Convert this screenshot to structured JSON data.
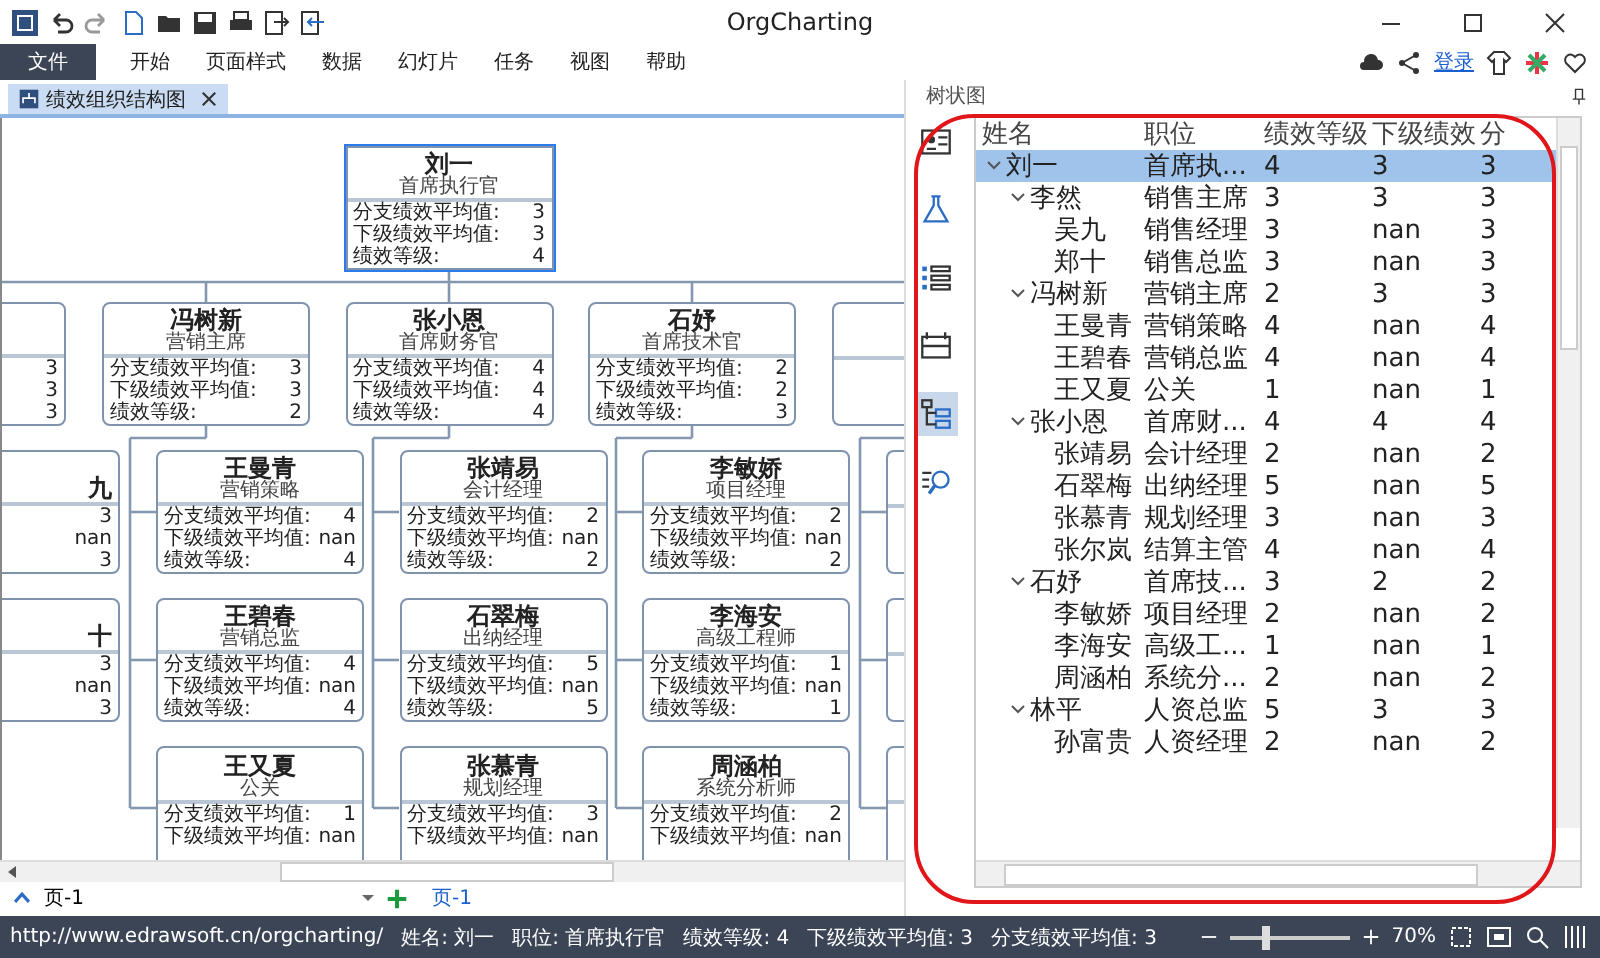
{
  "window": {
    "title": "OrgCharting"
  },
  "menu": [
    {
      "label": "文件",
      "selected": true
    },
    {
      "label": "开始",
      "selected": false
    },
    {
      "label": "页面样式",
      "selected": false
    },
    {
      "label": "数据",
      "selected": false
    },
    {
      "label": "幻灯片",
      "selected": false
    },
    {
      "label": "任务",
      "selected": false
    },
    {
      "label": "视图",
      "selected": false
    },
    {
      "label": "帮助",
      "selected": false
    }
  ],
  "login": "登录",
  "doc_tab": {
    "label": "绩效组织结构图"
  },
  "chart": {
    "root": {
      "kind": "full",
      "name": "刘一",
      "title": "首席执行官",
      "rows": [
        {
          "label": "分支绩效平均值:",
          "value": "3"
        },
        {
          "label": "下级绩效平均值:",
          "value": "3"
        },
        {
          "label": "绩效等级:",
          "value": "4"
        }
      ]
    },
    "columns": [
      {
        "head": {
          "kind": "cut_left",
          "rows": [
            {
              "value": "3"
            },
            {
              "value": "3"
            },
            {
              "value": "3"
            }
          ]
        },
        "children": [
          {
            "kind": "cut_left",
            "name": "九",
            "rows": [
              {
                "value": "3"
              },
              {
                "value": "nan"
              },
              {
                "value": "3"
              }
            ]
          },
          {
            "kind": "cut_left",
            "name": "十",
            "rows": [
              {
                "value": "3"
              },
              {
                "value": "nan"
              },
              {
                "value": "3"
              }
            ]
          }
        ]
      },
      {
        "head": {
          "kind": "full",
          "name": "冯树新",
          "title": "营销主席",
          "rows": [
            {
              "label": "分支绩效平均值:",
              "value": "3"
            },
            {
              "label": "下级绩效平均值:",
              "value": "3"
            },
            {
              "label": "绩效等级:",
              "value": "2"
            }
          ]
        },
        "children": [
          {
            "kind": "full",
            "name": "王曼青",
            "title": "营销策略",
            "rows": [
              {
                "label": "分支绩效平均值:",
                "value": "4"
              },
              {
                "label": "下级绩效平均值:",
                "value": "nan"
              },
              {
                "label": "绩效等级:",
                "value": "4"
              }
            ]
          },
          {
            "kind": "full",
            "name": "王碧春",
            "title": "营销总监",
            "rows": [
              {
                "label": "分支绩效平均值:",
                "value": "4"
              },
              {
                "label": "下级绩效平均值:",
                "value": "nan"
              },
              {
                "label": "绩效等级:",
                "value": "4"
              }
            ]
          },
          {
            "kind": "full",
            "name": "王又夏",
            "title": "公关",
            "rows": [
              {
                "label": "分支绩效平均值:",
                "value": "1"
              },
              {
                "label": "下级绩效平均值:",
                "value": "nan"
              }
            ]
          }
        ]
      },
      {
        "head": {
          "kind": "full",
          "name": "张小恩",
          "title": "首席财务官",
          "rows": [
            {
              "label": "分支绩效平均值:",
              "value": "4"
            },
            {
              "label": "下级绩效平均值:",
              "value": "4"
            },
            {
              "label": "绩效等级:",
              "value": "4"
            }
          ]
        },
        "children": [
          {
            "kind": "full",
            "name": "张靖易",
            "title": "会计经理",
            "rows": [
              {
                "label": "分支绩效平均值:",
                "value": "2"
              },
              {
                "label": "下级绩效平均值:",
                "value": "nan"
              },
              {
                "label": "绩效等级:",
                "value": "2"
              }
            ]
          },
          {
            "kind": "full",
            "name": "石翠梅",
            "title": "出纳经理",
            "rows": [
              {
                "label": "分支绩效平均值:",
                "value": "5"
              },
              {
                "label": "下级绩效平均值:",
                "value": "nan"
              },
              {
                "label": "绩效等级:",
                "value": "5"
              }
            ]
          },
          {
            "kind": "full",
            "name": "张慕青",
            "title": "规划经理",
            "rows": [
              {
                "label": "分支绩效平均值:",
                "value": "3"
              },
              {
                "label": "下级绩效平均值:",
                "value": "nan"
              }
            ]
          }
        ]
      },
      {
        "head": {
          "kind": "full",
          "name": "石妤",
          "title": "首席技术官",
          "rows": [
            {
              "label": "分支绩效平均值:",
              "value": "2"
            },
            {
              "label": "下级绩效平均值:",
              "value": "2"
            },
            {
              "label": "绩效等级:",
              "value": "3"
            }
          ]
        },
        "children": [
          {
            "kind": "full",
            "name": "李敏娇",
            "title": "项目经理",
            "rows": [
              {
                "label": "分支绩效平均值:",
                "value": "2"
              },
              {
                "label": "下级绩效平均值:",
                "value": "nan"
              },
              {
                "label": "绩效等级:",
                "value": "2"
              }
            ]
          },
          {
            "kind": "full",
            "name": "李海安",
            "title": "高级工程师",
            "rows": [
              {
                "label": "分支绩效平均值:",
                "value": "1"
              },
              {
                "label": "下级绩效平均值:",
                "value": "nan"
              },
              {
                "label": "绩效等级:",
                "value": "1"
              }
            ]
          },
          {
            "kind": "full",
            "name": "周涵柏",
            "title": "系统分析师",
            "rows": [
              {
                "label": "分支绩效平均值:",
                "value": "2"
              },
              {
                "label": "下级绩效平均值:",
                "value": "nan"
              }
            ]
          }
        ]
      },
      {
        "head": {
          "kind": "cut_right"
        },
        "children": [
          {
            "kind": "cut_right"
          },
          {
            "kind": "cut_right"
          },
          {
            "kind": "cut_right"
          }
        ]
      }
    ]
  },
  "page_bar": {
    "dropdown": "页-1",
    "tabs": [
      {
        "label": "页-1",
        "selected": true
      }
    ]
  },
  "tree_panel": {
    "title": "树状图",
    "side_icons": [
      {
        "kind": "card",
        "selected": false
      },
      {
        "kind": "flask",
        "selected": false
      },
      {
        "kind": "list",
        "selected": false
      },
      {
        "kind": "board",
        "selected": false
      },
      {
        "kind": "tree",
        "selected": true
      },
      {
        "kind": "search",
        "selected": false
      }
    ],
    "columns": [
      "姓名",
      "职位",
      "绩效等级",
      "下级绩效",
      "分"
    ],
    "rows": [
      {
        "cells": [
          "刘一",
          "首席执...",
          "4",
          "3",
          "3"
        ],
        "expanded": true,
        "selected": true,
        "children": [
          {
            "cells": [
              "李然",
              "销售主席",
              "3",
              "3",
              "3"
            ],
            "expanded": true,
            "selected": false,
            "children": [
              {
                "cells": [
                  "吴九",
                  "销售经理",
                  "3",
                  "nan",
                  "3"
                ],
                "selected": false
              },
              {
                "cells": [
                  "郑十",
                  "销售总监",
                  "3",
                  "nan",
                  "3"
                ],
                "selected": false
              }
            ]
          },
          {
            "cells": [
              "冯树新",
              "营销主席",
              "2",
              "3",
              "3"
            ],
            "expanded": true,
            "selected": false,
            "children": [
              {
                "cells": [
                  "王曼青",
                  "营销策略",
                  "4",
                  "nan",
                  "4"
                ],
                "selected": false
              },
              {
                "cells": [
                  "王碧春",
                  "营销总监",
                  "4",
                  "nan",
                  "4"
                ],
                "selected": false
              },
              {
                "cells": [
                  "王又夏",
                  "公关",
                  "1",
                  "nan",
                  "1"
                ],
                "selected": false
              }
            ]
          },
          {
            "cells": [
              "张小恩",
              "首席财...",
              "4",
              "4",
              "4"
            ],
            "expanded": true,
            "selected": false,
            "children": [
              {
                "cells": [
                  "张靖易",
                  "会计经理",
                  "2",
                  "nan",
                  "2"
                ],
                "selected": false
              },
              {
                "cells": [
                  "石翠梅",
                  "出纳经理",
                  "5",
                  "nan",
                  "5"
                ],
                "selected": false
              },
              {
                "cells": [
                  "张慕青",
                  "规划经理",
                  "3",
                  "nan",
                  "3"
                ],
                "selected": false
              },
              {
                "cells": [
                  "张尔岚",
                  "结算主管",
                  "4",
                  "nan",
                  "4"
                ],
                "selected": false
              }
            ]
          },
          {
            "cells": [
              "石妤",
              "首席技...",
              "3",
              "2",
              "2"
            ],
            "expanded": true,
            "selected": false,
            "children": [
              {
                "cells": [
                  "李敏娇",
                  "项目经理",
                  "2",
                  "nan",
                  "2"
                ],
                "selected": false
              },
              {
                "cells": [
                  "李海安",
                  "高级工...",
                  "1",
                  "nan",
                  "1"
                ],
                "selected": false
              },
              {
                "cells": [
                  "周涵柏",
                  "系统分...",
                  "2",
                  "nan",
                  "2"
                ],
                "selected": false
              }
            ]
          },
          {
            "cells": [
              "林平",
              "人资总监",
              "5",
              "3",
              "3"
            ],
            "expanded": true,
            "selected": false,
            "children": [
              {
                "cells": [
                  "孙富贵",
                  "人资经理",
                  "2",
                  "nan",
                  "2"
                ],
                "selected": false
              }
            ]
          }
        ]
      }
    ]
  },
  "status_bar": {
    "link": "http://www.edrawsoft.cn/orgcharting/",
    "fields": [
      "姓名: 刘一",
      "职位: 首席执行官",
      "绩效等级: 4",
      "下级绩效平均值: 3",
      "分支绩效平均值: 3"
    ],
    "zoom": {
      "level": 0.3,
      "reading": "70%"
    }
  }
}
